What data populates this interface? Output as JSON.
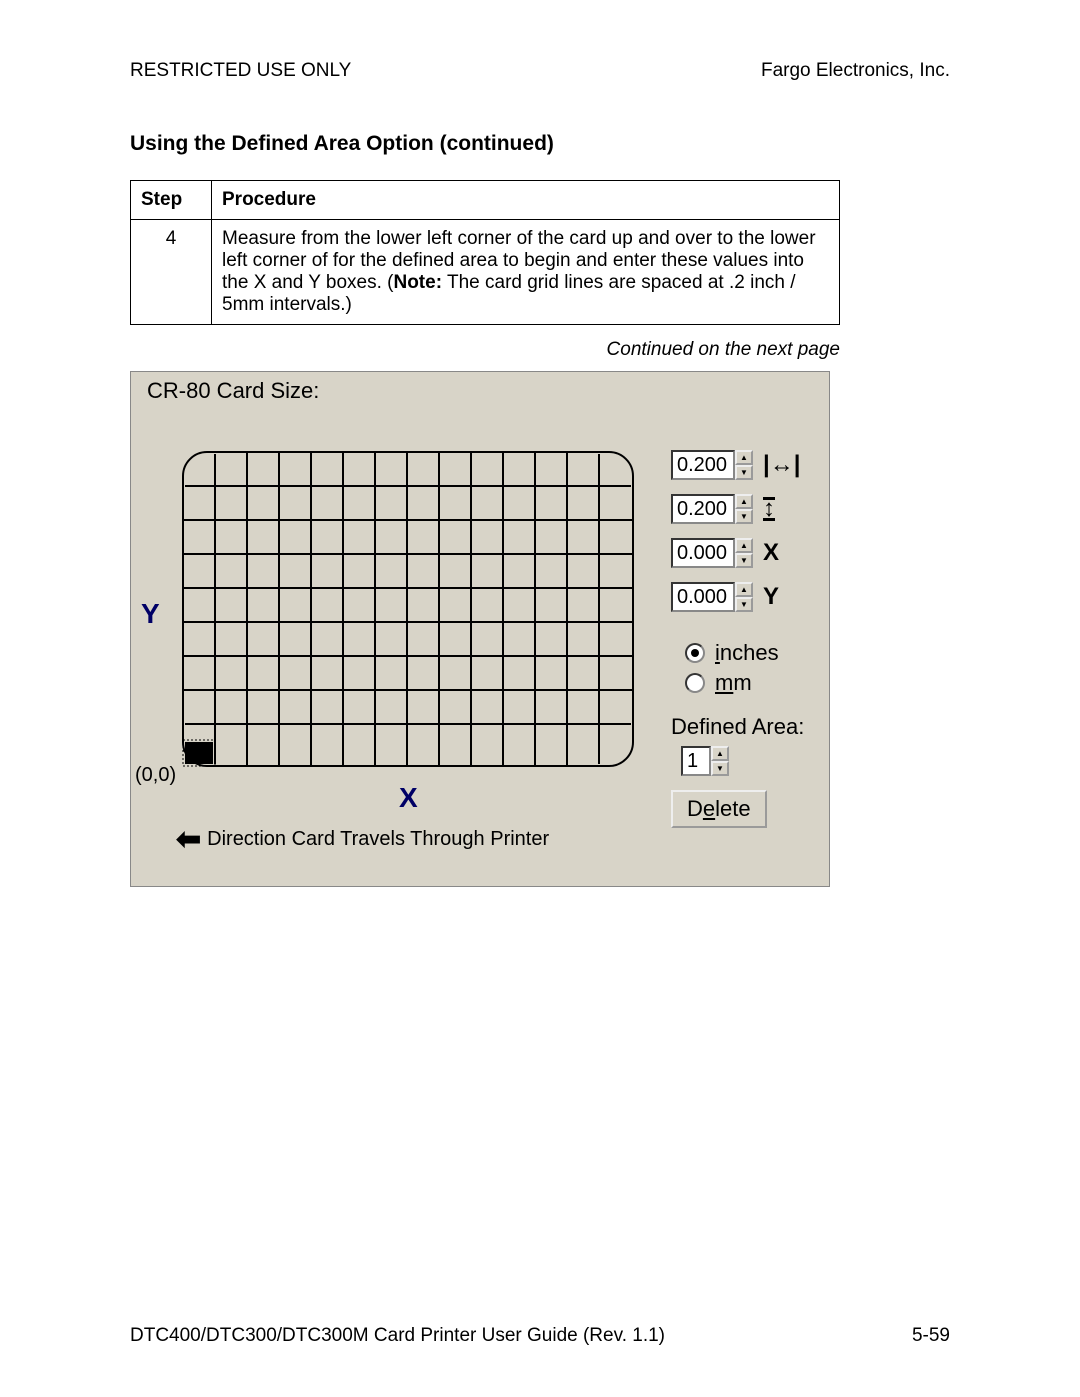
{
  "header": {
    "left": "RESTRICTED USE ONLY",
    "right": "Fargo Electronics, Inc."
  },
  "section_title": "Using the Defined Area Option (continued)",
  "table": {
    "head_step": "Step",
    "head_proc": "Procedure",
    "row": {
      "step": "4",
      "text_before_note": "Measure from the lower left corner of the card up and over to the lower left corner of for the defined area to begin and enter these values into the X and Y boxes. (",
      "note_label": "Note:",
      "text_after_note": "  The card grid lines are spaced at .2 inch / 5mm intervals.)"
    }
  },
  "continued": "Continued on the next page",
  "panel": {
    "title": "CR-80 Card Size:",
    "y_axis": "Y",
    "x_axis": "X",
    "origin": "(0,0)",
    "direction": "Direction Card Travels Through Printer",
    "spinners": {
      "width": "0.200",
      "height": "0.200",
      "x": "0.000",
      "y": "0.000"
    },
    "icons": {
      "width": "↔",
      "height": "↕",
      "x": "X",
      "y": "Y"
    },
    "units": {
      "inches_u": "i",
      "inches_rest": "nches",
      "mm_u": "m",
      "mm_rest": "m"
    },
    "defined_area_label": "Defined Area:",
    "defined_area_value": "1",
    "delete_u": "e",
    "delete_before": "D",
    "delete_after": "lete"
  },
  "footer": {
    "left": "DTC400/DTC300/DTC300M Card Printer User Guide (Rev. 1.1)",
    "right": "5-59"
  }
}
